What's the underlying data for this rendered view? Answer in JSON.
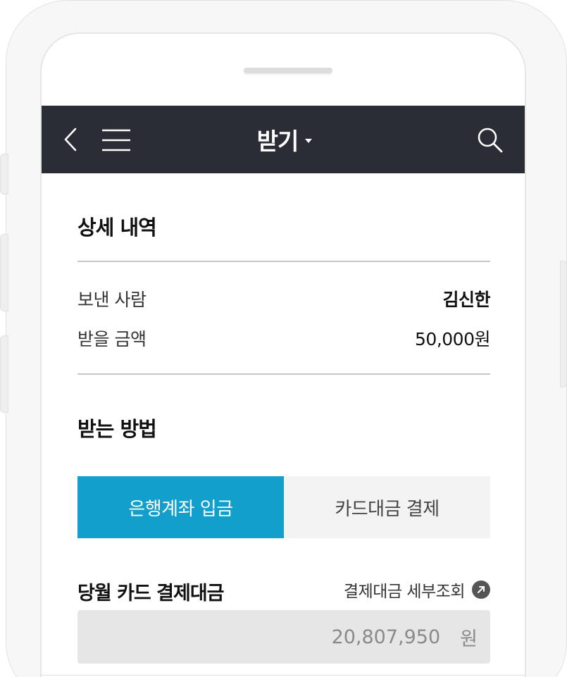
{
  "header": {
    "title": "받기",
    "icons": {
      "back": "chevron-left-icon",
      "menu": "hamburger-menu-icon",
      "title_dropdown": "caret-down-icon",
      "search": "search-icon"
    },
    "background_color": "#2a2d35"
  },
  "details": {
    "title": "상세 내역",
    "rows": [
      {
        "label": "보낸 사람",
        "value": "김신한"
      },
      {
        "label": "받을 금액",
        "value": "50,000원"
      }
    ]
  },
  "method": {
    "title": "받는 방법",
    "tabs": [
      {
        "label": "은행계좌 입금",
        "active": true
      },
      {
        "label": "카드대금 결제",
        "active": false
      }
    ],
    "active_color": "#129fcb"
  },
  "card_payment": {
    "title": "당월 카드 결제대금",
    "detail_link": "결제대금 세부조회",
    "detail_link_icon": "arrow-up-right-circle-icon",
    "amount": "20,807,950",
    "unit": "원"
  }
}
